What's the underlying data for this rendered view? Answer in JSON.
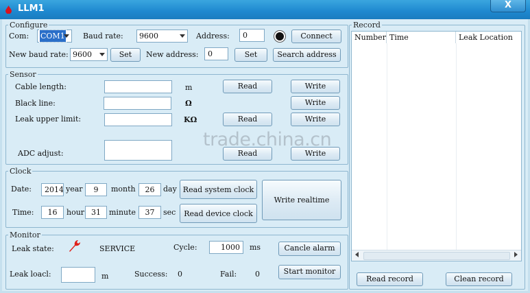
{
  "window": {
    "title": "LLM1",
    "close_glyph": "X"
  },
  "configure": {
    "legend": "Configure",
    "com_label": "Com:",
    "com_value": "COM1",
    "baud_label": "Baud rate:",
    "baud_value": "9600",
    "address_label": "Address:",
    "address_value": "0",
    "connect_label": "Connect",
    "new_baud_label": "New baud rate:",
    "new_baud_value": "9600",
    "set_label": "Set",
    "new_address_label": "New address:",
    "new_address_value": "0",
    "search_label": "Search address"
  },
  "sensor": {
    "legend": "Sensor",
    "cable_label": "Cable length:",
    "cable_unit": "m",
    "black_label": "Black line:",
    "black_unit": "Ω",
    "leak_upper_label": "Leak upper limit:",
    "leak_upper_unit": "KΩ",
    "adc_label": "ADC adjust:",
    "read_label": "Read",
    "write_label": "Write"
  },
  "clock": {
    "legend": "Clock",
    "date_label": "Date:",
    "year_value": "2014",
    "year_label": "year",
    "month_value": "9",
    "month_label": "month",
    "day_value": "26",
    "day_label": "day",
    "read_system_label": "Read system clock",
    "time_label": "Time:",
    "hour_value": "16",
    "hour_label": "hour",
    "minute_value": "31",
    "minute_label": "minute",
    "sec_value": "37",
    "sec_label": "sec",
    "read_device_label": "Read device clock",
    "write_realtime_label": "Write realtime"
  },
  "monitor": {
    "legend": "Monitor",
    "leak_state_label": "Leak state:",
    "leak_state_value": "SERVICE",
    "cycle_label": "Cycle:",
    "cycle_value": "1000",
    "cycle_unit": "ms",
    "cancel_alarm_label": "Cancle alarm",
    "leak_loacl_label": "Leak loacl:",
    "leak_loacl_unit": "m",
    "success_label": "Success:",
    "success_value": "0",
    "fail_label": "Fail:",
    "fail_value": "0",
    "start_monitor_label": "Start monitor",
    "icons": [
      "wrench-icon"
    ],
    "wrench_color": "#e0201a"
  },
  "record": {
    "legend": "Record",
    "columns": [
      "Number",
      "Time",
      "Leak Location"
    ],
    "read_record_label": "Read record",
    "clean_record_label": "Clean record"
  },
  "watermark": "trade.china.cn"
}
